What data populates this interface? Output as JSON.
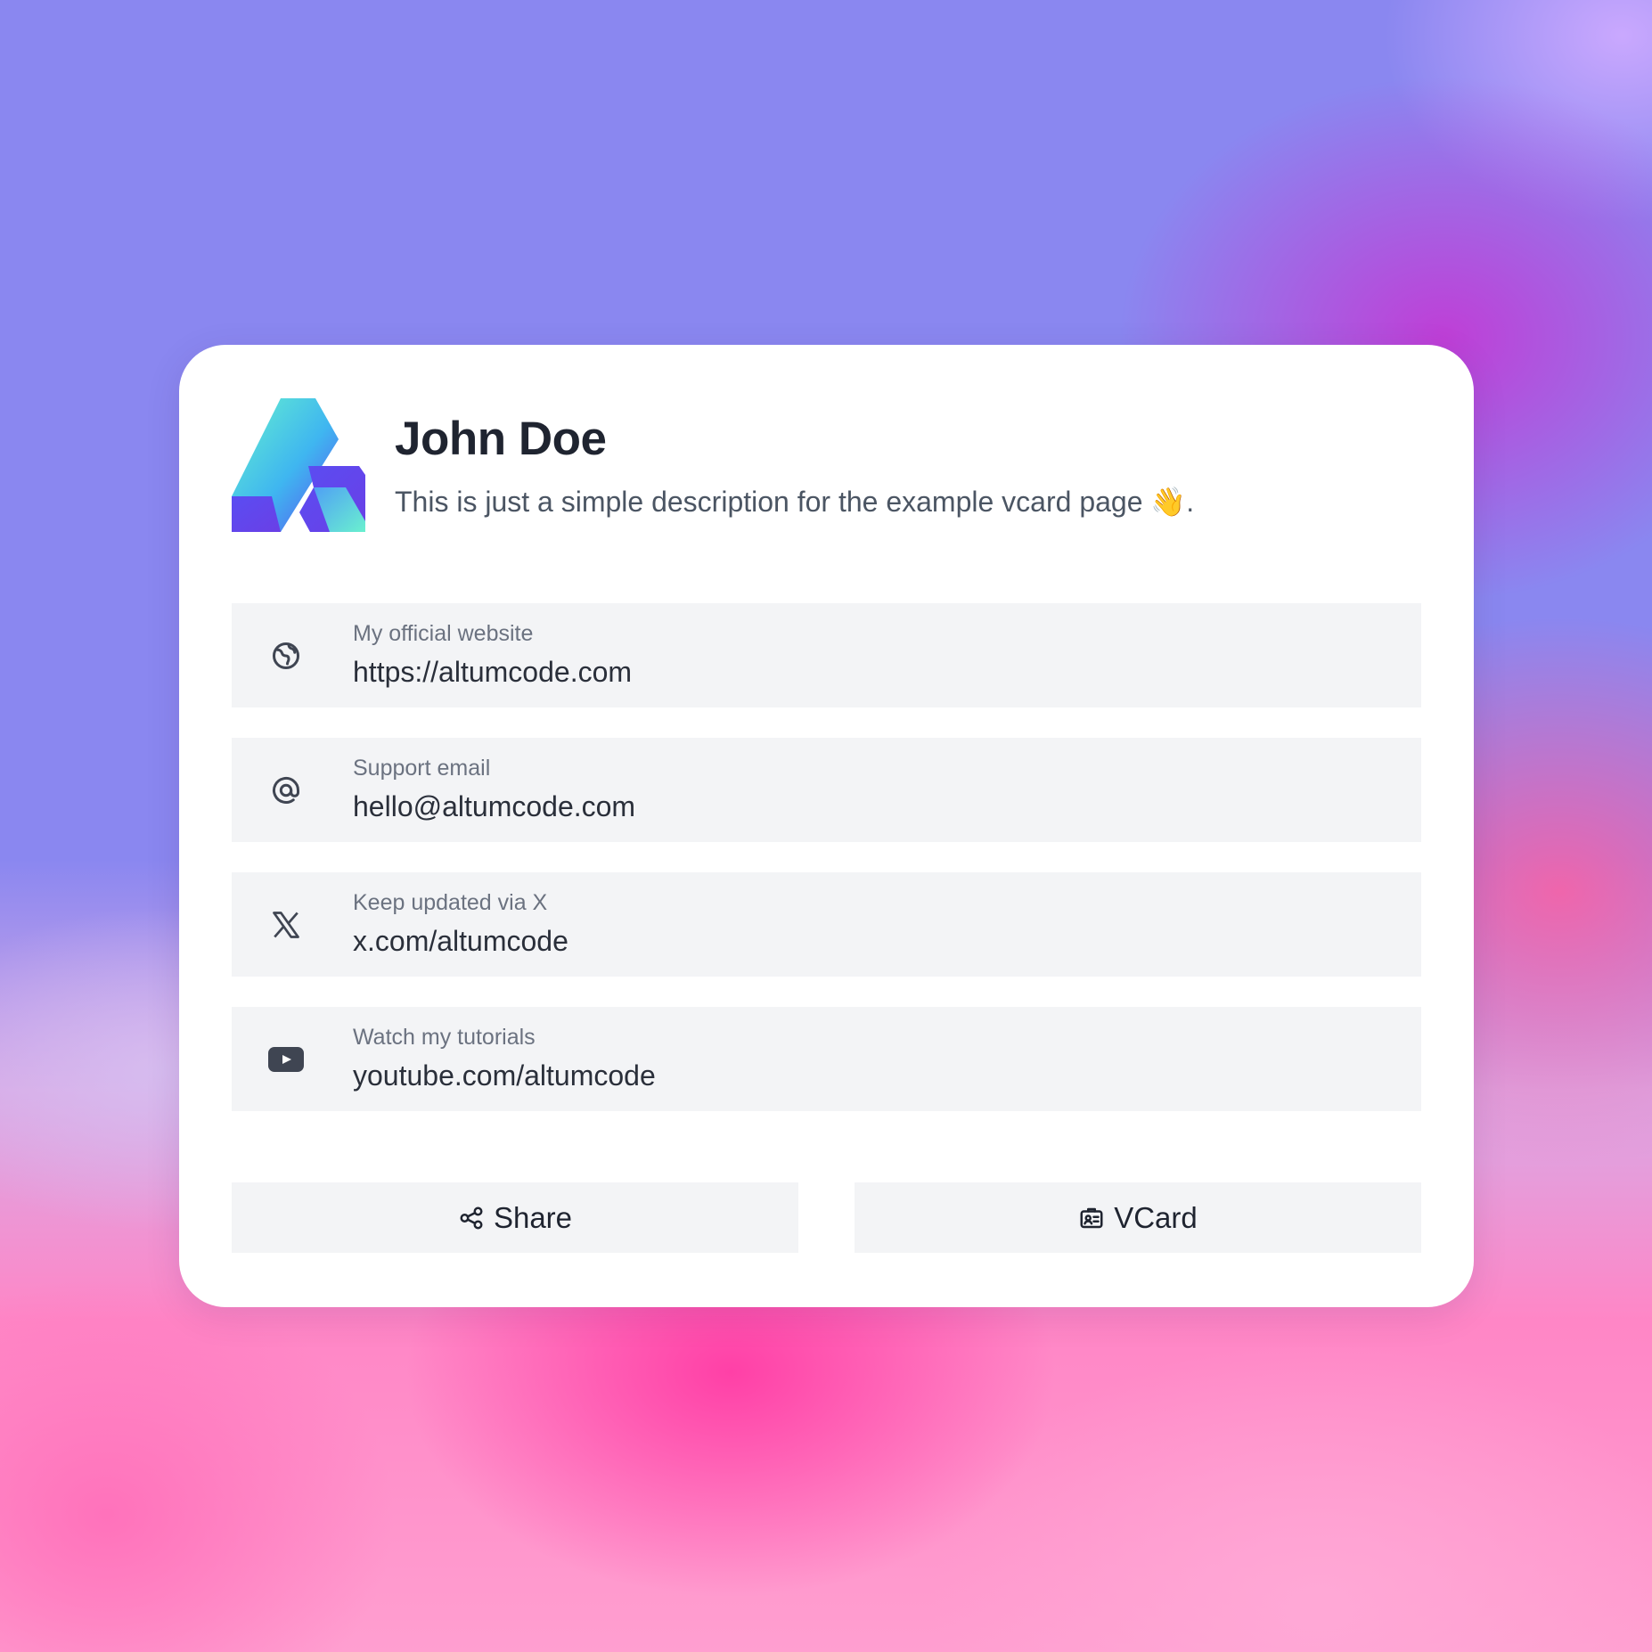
{
  "profile": {
    "name": "John Doe",
    "description": "This is just a simple description for the example vcard page 👋."
  },
  "links": [
    {
      "icon": "globe-icon",
      "label": "My official website",
      "value": "https://altumcode.com"
    },
    {
      "icon": "at-sign-icon",
      "label": "Support email",
      "value": "hello@altumcode.com"
    },
    {
      "icon": "x-logo-icon",
      "label": "Keep updated via X",
      "value": "x.com/altumcode"
    },
    {
      "icon": "youtube-icon",
      "label": "Watch my tutorials",
      "value": "youtube.com/altumcode"
    }
  ],
  "actions": {
    "share_label": "Share",
    "vcard_label": "VCard"
  },
  "colors": {
    "card_background": "#ffffff",
    "row_background": "#f3f4f6",
    "text_primary": "#1f2430",
    "text_secondary": "#6b7280",
    "logo_gradient_start": "#5ff0d0",
    "logo_gradient_end": "#5b4ef0"
  }
}
